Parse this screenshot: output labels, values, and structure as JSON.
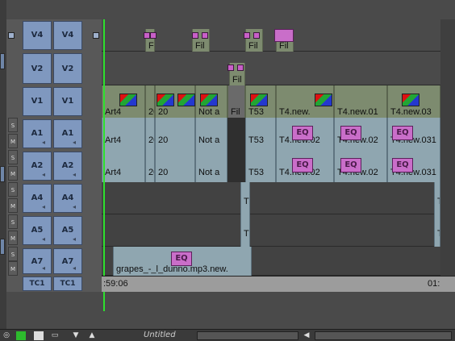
{
  "tracks": {
    "video": [
      {
        "name_left": "V4",
        "name_right": "V4"
      },
      {
        "name_left": "V2",
        "name_right": "V2"
      },
      {
        "name_left": "V1",
        "name_right": "V1"
      }
    ],
    "audio": [
      {
        "name_left": "A1",
        "name_right": "A1"
      },
      {
        "name_left": "A2",
        "name_right": "A2"
      },
      {
        "name_left": "A4",
        "name_right": "A4"
      },
      {
        "name_left": "A5",
        "name_right": "A5"
      },
      {
        "name_left": "A7",
        "name_right": "A7"
      }
    ],
    "timecode": {
      "name_left": "TC1",
      "name_right": "TC1"
    },
    "solo_label": "S",
    "mute_label": "M"
  },
  "clips": {
    "v4": [
      "F",
      "Fil",
      "Fil",
      "Fil"
    ],
    "v2": "Fil",
    "v1": [
      "Art4",
      "20",
      "20",
      "Not a",
      "Fil",
      "T53",
      "T4.new.",
      "T4.new.01",
      "T4.new.03"
    ],
    "a1": [
      "Art4",
      "20",
      "20",
      "Not a",
      "T53",
      "T4.new.02",
      "T4.new.02",
      "T4.new.031"
    ],
    "a2": [
      "Art4",
      "20",
      "20",
      "Not a",
      "T53",
      "T4.new.02",
      "T4.new.02",
      "T4.new.031"
    ],
    "a4": [
      "T",
      "T"
    ],
    "a5": [
      "T",
      "T"
    ],
    "a7": "grapes_-_l_dunno.mp3.new.",
    "eq_label": "EQ"
  },
  "timecode": {
    "left": ":59:06",
    "right": "01:"
  },
  "sequence_title": "Untitled"
}
